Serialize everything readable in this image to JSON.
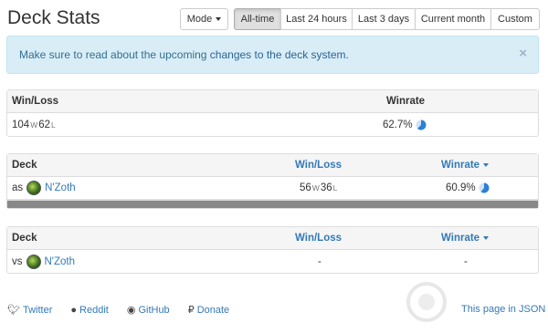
{
  "page": {
    "title": "Deck Stats"
  },
  "filters": {
    "mode_label": "Mode",
    "ranges": [
      "All-time",
      "Last 24 hours",
      "Last 3 days",
      "Current month",
      "Custom"
    ],
    "active": "All-time"
  },
  "alert": {
    "prefix": "Make sure to read about the upcoming ",
    "link": "changes to the deck system.",
    "close": "×"
  },
  "summary": {
    "headers": {
      "winloss": "Win/Loss",
      "winrate": "Winrate"
    },
    "wins": "104",
    "w_suffix": "W",
    "losses": "62",
    "l_suffix": "L",
    "winrate": "62.7%",
    "winrate_fraction": 0.627
  },
  "as_table": {
    "headers": {
      "deck": "Deck",
      "winloss": "Win/Loss",
      "winrate": "Winrate"
    },
    "rows": [
      {
        "prefix": "as",
        "deck": "N'Zoth",
        "wins": "56",
        "losses": "36",
        "winrate": "60.9%",
        "winrate_fraction": 0.609
      }
    ]
  },
  "vs_table": {
    "headers": {
      "deck": "Deck",
      "winloss": "Win/Loss",
      "winrate": "Winrate"
    },
    "rows": [
      {
        "prefix": "vs",
        "deck": "N'Zoth",
        "winloss": "-",
        "winrate": "-"
      }
    ]
  },
  "footer": {
    "links": [
      "Twitter",
      "Reddit",
      "GitHub",
      "Donate"
    ],
    "json_link": "This page in JSON"
  },
  "colors": {
    "link": "#337ab7",
    "alert_bg": "#d9edf7",
    "pie": "#2b7fd4"
  }
}
